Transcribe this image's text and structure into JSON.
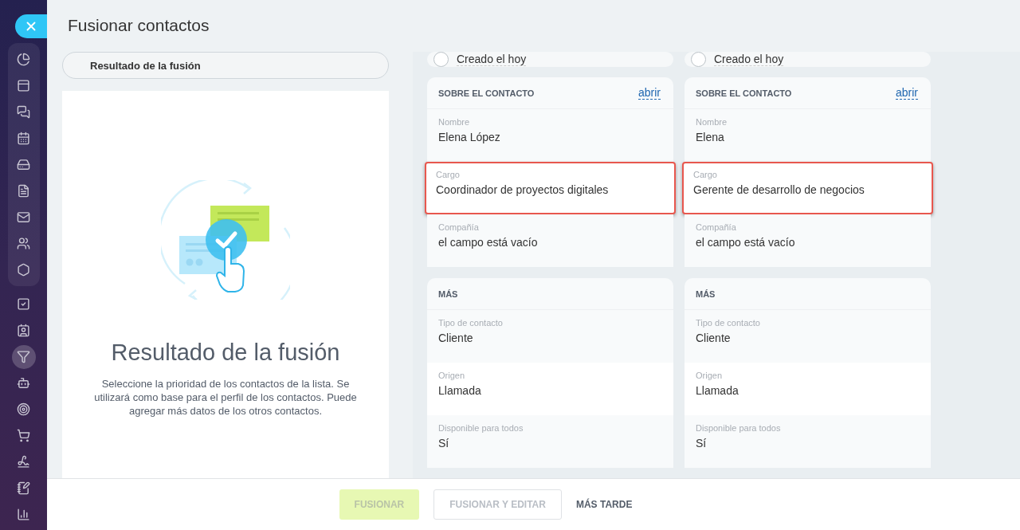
{
  "sidebar": {
    "pinned_items": [
      {
        "selected": false
      },
      {
        "selected": false
      },
      {
        "selected": false
      },
      {
        "selected": false
      },
      {
        "selected": false
      },
      {
        "selected": false
      },
      {
        "selected": false
      },
      {
        "selected": false
      },
      {
        "selected": false
      }
    ],
    "items": [
      {
        "selected": false
      },
      {
        "selected": false
      },
      {
        "selected": true
      },
      {
        "selected": false
      },
      {
        "selected": false
      },
      {
        "selected": false
      },
      {
        "selected": false
      },
      {
        "selected": false
      },
      {
        "selected": false
      }
    ]
  },
  "title": "Fusionar contactos",
  "result": {
    "tab": "Resultado de la fusión",
    "heading": "Resultado de la fusión",
    "description": "Seleccione la prioridad de los contactos de la lista. Se utilizará como base para el perfil de los contactos. Puede agregar más datos de los otros contactos."
  },
  "contacts": [
    {
      "label": "Creado el hoy",
      "selected": false,
      "sections": [
        {
          "title": "SOBRE EL CONTACTO",
          "link": "abrir",
          "fields": [
            {
              "label": "Nombre",
              "value": "Elena López",
              "highlighted": false
            },
            {
              "label": "Cargo",
              "value": "Coordinador de proyectos digitales",
              "highlighted": true
            },
            {
              "label": "Compañía",
              "value": "el campo está vacío",
              "highlighted": false
            }
          ]
        },
        {
          "title": "MÁS",
          "fields": [
            {
              "label": "Tipo de contacto",
              "value": "Cliente",
              "highlighted": false
            },
            {
              "label": "Origen",
              "value": "Llamada",
              "highlighted": false
            },
            {
              "label": "Disponible para todos",
              "value": "Sí",
              "highlighted": false
            }
          ]
        }
      ]
    },
    {
      "label": "Creado el hoy",
      "selected": false,
      "sections": [
        {
          "title": "SOBRE EL CONTACTO",
          "link": "abrir",
          "fields": [
            {
              "label": "Nombre",
              "value": "Elena",
              "highlighted": false
            },
            {
              "label": "Cargo",
              "value": "Gerente de desarrollo de negocios",
              "highlighted": true
            },
            {
              "label": "Compañía",
              "value": "el campo está vacío",
              "highlighted": false
            }
          ]
        },
        {
          "title": "MÁS",
          "fields": [
            {
              "label": "Tipo de contacto",
              "value": "Cliente",
              "highlighted": false
            },
            {
              "label": "Origen",
              "value": "Llamada",
              "highlighted": false
            },
            {
              "label": "Disponible para todos",
              "value": "Sí",
              "highlighted": false
            }
          ]
        }
      ]
    }
  ],
  "buttons": [
    {
      "label": "FUSIONAR",
      "kind": "primary",
      "disabled": true
    },
    {
      "label": "FUSIONAR Y EDITAR",
      "kind": "secondary",
      "disabled": true
    },
    {
      "label": "MÁS TARDE",
      "kind": "link",
      "disabled": false
    }
  ]
}
